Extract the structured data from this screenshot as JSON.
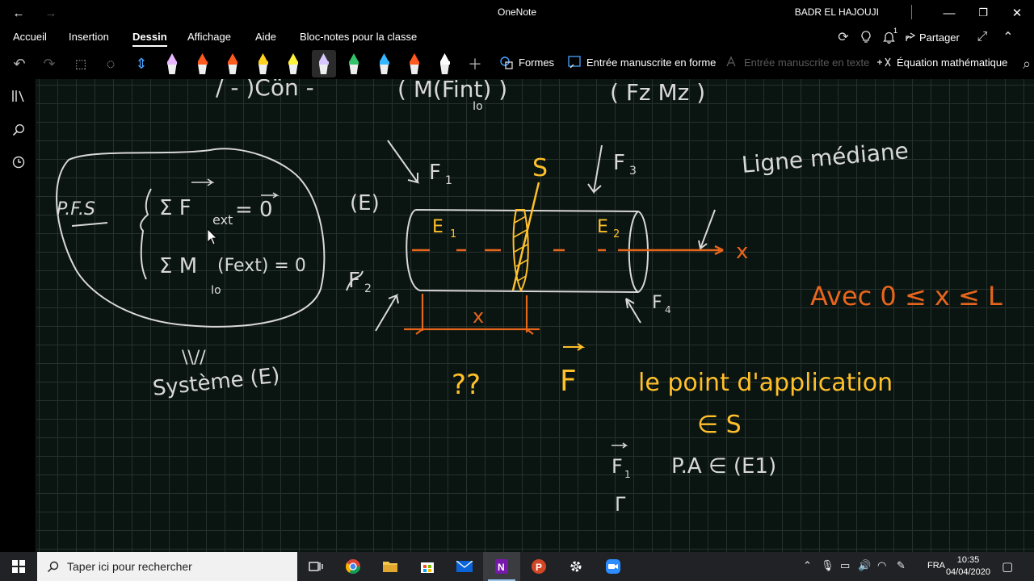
{
  "window": {
    "title": "OneNote",
    "user": "BADR EL HAJOUJI"
  },
  "menu": {
    "tabs": [
      "Accueil",
      "Insertion",
      "Dessin",
      "Affichage",
      "Aide",
      "Bloc-notes pour la classe"
    ],
    "active": "Dessin",
    "share_label": "Partager",
    "notification_count": "1"
  },
  "ribbon": {
    "shapes_label": "Formes",
    "ink_to_shape_label": "Entrée manuscrite en forme",
    "ink_to_text_label": "Entrée manuscrite en texte",
    "math_label": "Équation mathématique",
    "pen_colors": [
      "#e8b7ff",
      "#ff5a1f",
      "#ff5a1f",
      "#ffd21f",
      "#fff23a",
      "#d8c6ff",
      "#33c36b",
      "#35b6ff",
      "#ff5a1f",
      "#ffffff"
    ],
    "selected_pen": 5
  },
  "notes": {
    "top_partial_left": "/ - )Cön -",
    "top_partial_mid": "( M(Fint) )",
    "top_partial_mid_sub": "Io",
    "top_partial_right": "( Fz   Mz )",
    "pfs": "P.F.S",
    "sum_forces_a": "Σ F",
    "sum_forces_sub": "ext",
    "sum_forces_b": "= 0",
    "sum_moments_a": "Σ M",
    "sum_moments_sub": "Io",
    "sum_moments_b": "(Fext) = 0",
    "arrow_mark": "\\\\//",
    "system": "Système (E)",
    "body_label": "(E)",
    "f1": "F",
    "f1_sub": "1",
    "f2": "F",
    "f2_sub": "2",
    "f3": "F",
    "f3_sub": "3",
    "f4": "F",
    "f4_sub": "4",
    "e1": "E",
    "e1_sub": "1",
    "e2": "E",
    "e2_sub": "2",
    "section": "S",
    "x_axis": "x",
    "x_dim": "x",
    "ligne": "Ligne médiane",
    "avec": "Avec  0 ≤ x ≤ L",
    "question": "??",
    "f_vec": "F",
    "point": "le  point  d'application",
    "in_s": "∈ S",
    "f1_bottom": "F",
    "f1_bottom_sub": "1",
    "pa": "P.A ∈ (E1)",
    "pa_tail": "Γ"
  },
  "colors": {
    "ink_white": "#d8d8d8",
    "ink_yellow": "#ffc02a",
    "ink_orange": "#e8651c",
    "grid": "#26302c",
    "page_bg": "#0a1411",
    "taskbar_bg": "#202225"
  },
  "taskbar": {
    "search_placeholder": "Taper ici pour rechercher",
    "apps": [
      "task-view-icon",
      "chrome-icon",
      "explorer-icon",
      "store-icon",
      "mail-icon",
      "onenote-icon",
      "powerpoint-icon",
      "settings-icon",
      "zoom-icon"
    ],
    "active_app": "onenote-icon",
    "language": "FRA",
    "time": "10:35",
    "date": "04/04/2020"
  }
}
